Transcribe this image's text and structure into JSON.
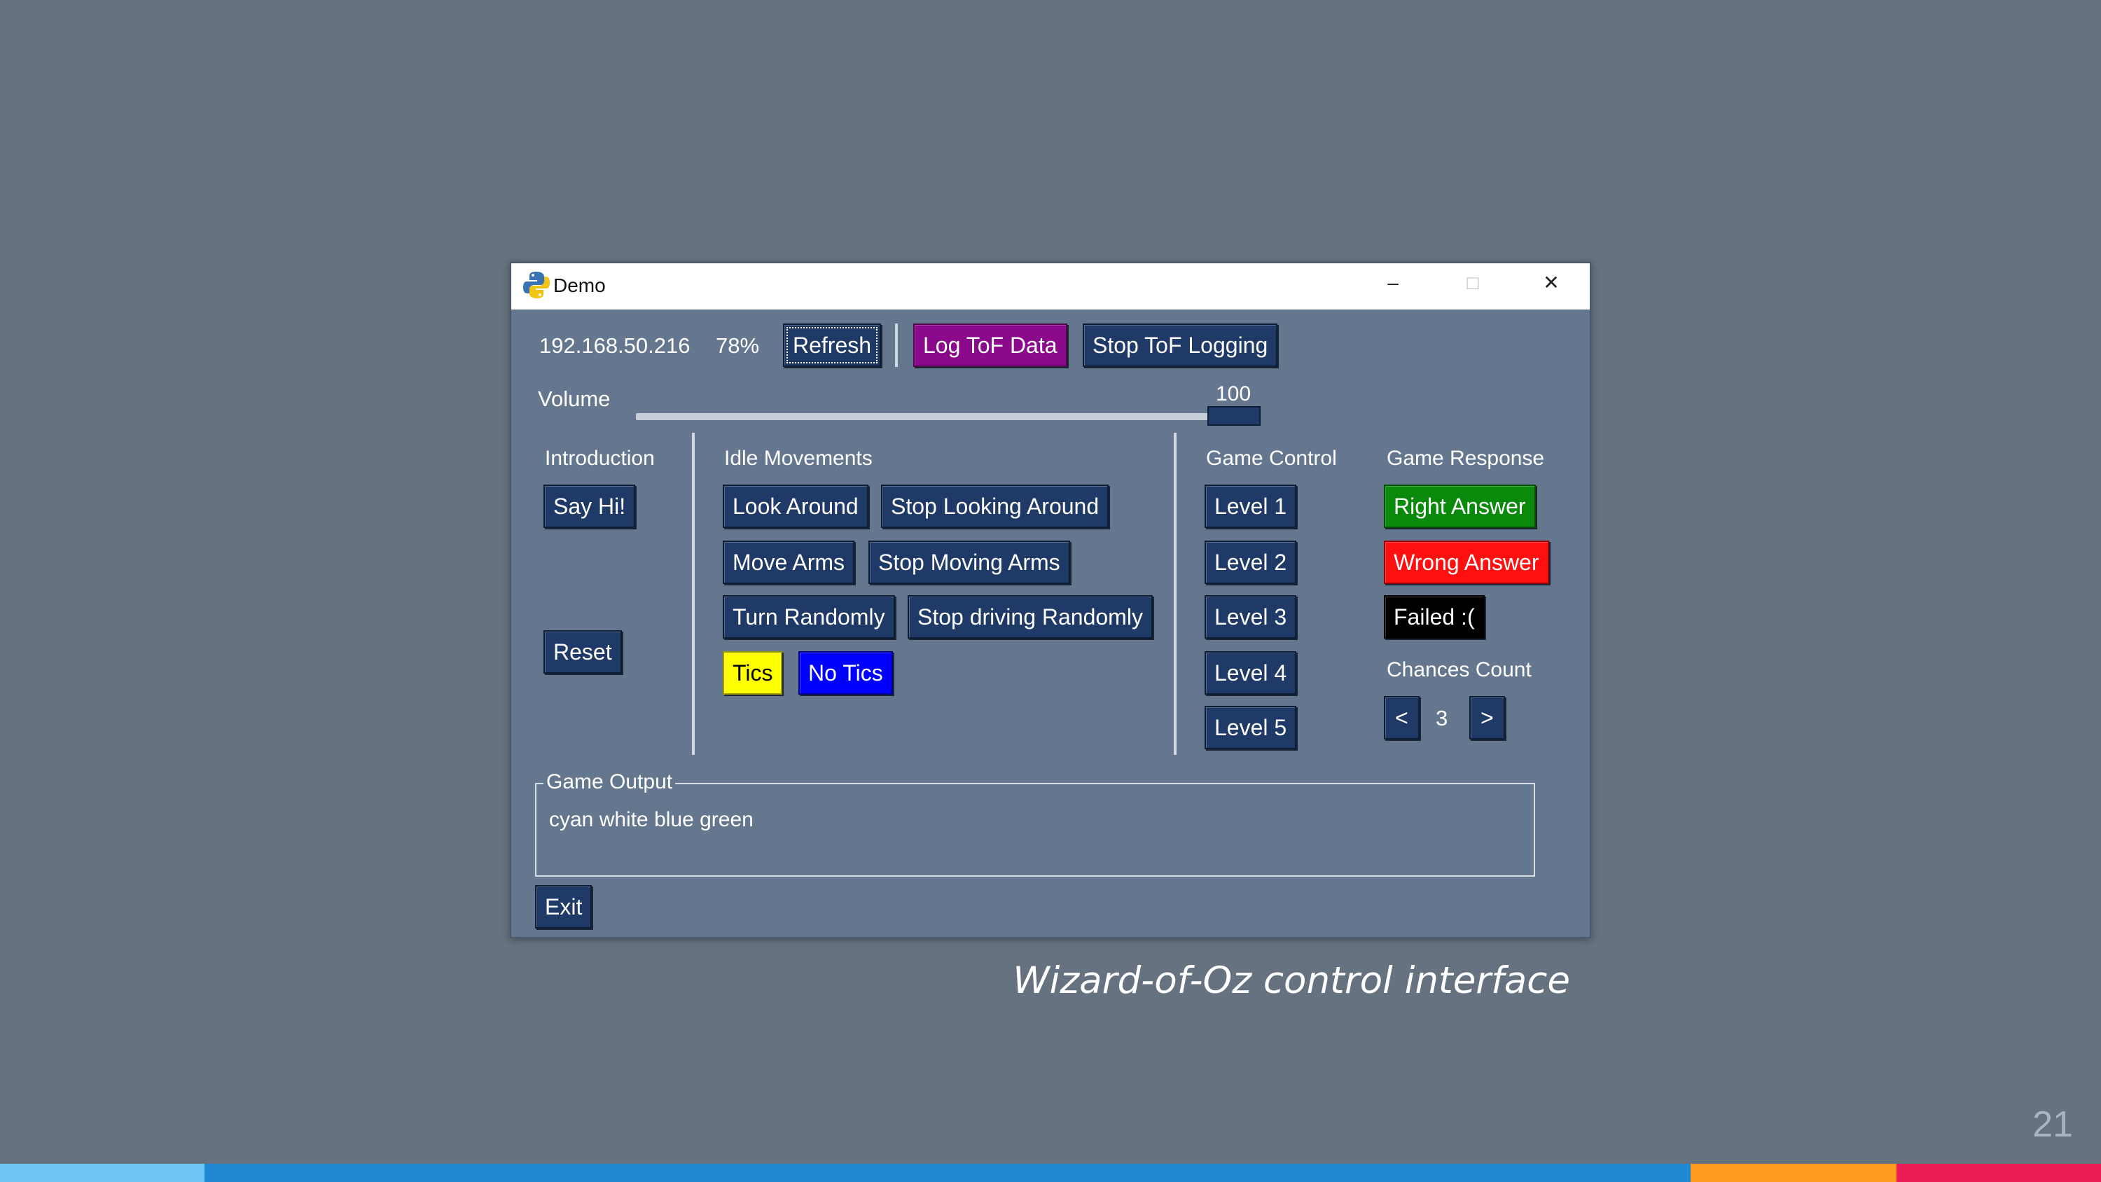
{
  "window": {
    "title": "Demo",
    "minimize": "–",
    "maximize": "□",
    "close": "✕",
    "app_icon": "python-logo-icon"
  },
  "top_bar": {
    "ip": "192.168.50.216",
    "battery": "78%",
    "refresh_label": "Refresh",
    "log_tof_label": "Log ToF Data",
    "stop_tof_label": "Stop ToF Logging"
  },
  "volume": {
    "label": "Volume",
    "value": 100,
    "value_text": "100"
  },
  "introduction": {
    "header": "Introduction",
    "say_hi_label": "Say Hi!",
    "reset_label": "Reset"
  },
  "idle": {
    "header": "Idle Movements",
    "look_around": "Look Around",
    "stop_looking_around": "Stop Looking Around",
    "move_arms": "Move Arms",
    "stop_moving_arms": "Stop Moving Arms",
    "turn_randomly": "Turn Randomly",
    "stop_driving_randomly": "Stop driving Randomly",
    "tics": "Tics",
    "no_tics": "No Tics"
  },
  "game_control": {
    "header": "Game Control",
    "levels": [
      "Level 1",
      "Level 2",
      "Level 3",
      "Level 4",
      "Level 5"
    ]
  },
  "game_response": {
    "header": "Game Response",
    "right_answer": "Right Answer",
    "wrong_answer": "Wrong Answer",
    "failed": "Failed :(",
    "chances_label": "Chances Count",
    "decrement": "<",
    "chances_value": "3",
    "increment": ">"
  },
  "game_output": {
    "legend": "Game Output",
    "text": "cyan white blue green"
  },
  "exit_label": "Exit",
  "slide": {
    "caption": "Wizard-of-Oz control interface",
    "page_number": "21"
  },
  "colors": {
    "slide_bg": "#66727f",
    "window_bg": "#64778f",
    "button_navy": "#1f3a66",
    "purple": "#8b0a8b",
    "green": "#0a8a0a",
    "red": "#ff0f0f",
    "yellow": "#ffff00",
    "blue": "#0000ff",
    "bar_light_blue": "#6ec6f5",
    "bar_blue": "#1e88d2",
    "bar_orange": "#ff9a1f",
    "bar_pink": "#ec1d56"
  }
}
